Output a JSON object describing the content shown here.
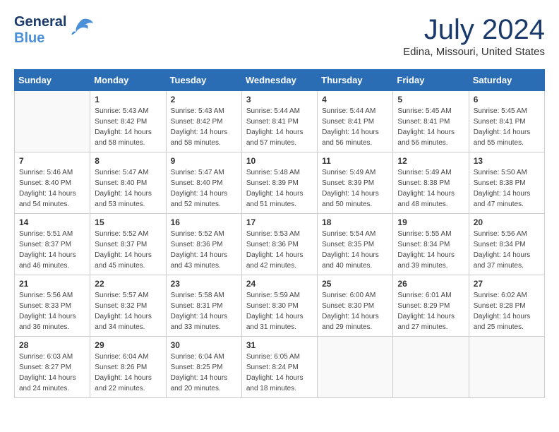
{
  "logo": {
    "line1": "General",
    "line2": "Blue"
  },
  "title": "July 2024",
  "location": "Edina, Missouri, United States",
  "days_of_week": [
    "Sunday",
    "Monday",
    "Tuesday",
    "Wednesday",
    "Thursday",
    "Friday",
    "Saturday"
  ],
  "weeks": [
    [
      {
        "day": "",
        "info": ""
      },
      {
        "day": "1",
        "info": "Sunrise: 5:43 AM\nSunset: 8:42 PM\nDaylight: 14 hours\nand 58 minutes."
      },
      {
        "day": "2",
        "info": "Sunrise: 5:43 AM\nSunset: 8:42 PM\nDaylight: 14 hours\nand 58 minutes."
      },
      {
        "day": "3",
        "info": "Sunrise: 5:44 AM\nSunset: 8:41 PM\nDaylight: 14 hours\nand 57 minutes."
      },
      {
        "day": "4",
        "info": "Sunrise: 5:44 AM\nSunset: 8:41 PM\nDaylight: 14 hours\nand 56 minutes."
      },
      {
        "day": "5",
        "info": "Sunrise: 5:45 AM\nSunset: 8:41 PM\nDaylight: 14 hours\nand 56 minutes."
      },
      {
        "day": "6",
        "info": "Sunrise: 5:45 AM\nSunset: 8:41 PM\nDaylight: 14 hours\nand 55 minutes."
      }
    ],
    [
      {
        "day": "7",
        "info": "Sunrise: 5:46 AM\nSunset: 8:40 PM\nDaylight: 14 hours\nand 54 minutes."
      },
      {
        "day": "8",
        "info": "Sunrise: 5:47 AM\nSunset: 8:40 PM\nDaylight: 14 hours\nand 53 minutes."
      },
      {
        "day": "9",
        "info": "Sunrise: 5:47 AM\nSunset: 8:40 PM\nDaylight: 14 hours\nand 52 minutes."
      },
      {
        "day": "10",
        "info": "Sunrise: 5:48 AM\nSunset: 8:39 PM\nDaylight: 14 hours\nand 51 minutes."
      },
      {
        "day": "11",
        "info": "Sunrise: 5:49 AM\nSunset: 8:39 PM\nDaylight: 14 hours\nand 50 minutes."
      },
      {
        "day": "12",
        "info": "Sunrise: 5:49 AM\nSunset: 8:38 PM\nDaylight: 14 hours\nand 48 minutes."
      },
      {
        "day": "13",
        "info": "Sunrise: 5:50 AM\nSunset: 8:38 PM\nDaylight: 14 hours\nand 47 minutes."
      }
    ],
    [
      {
        "day": "14",
        "info": "Sunrise: 5:51 AM\nSunset: 8:37 PM\nDaylight: 14 hours\nand 46 minutes."
      },
      {
        "day": "15",
        "info": "Sunrise: 5:52 AM\nSunset: 8:37 PM\nDaylight: 14 hours\nand 45 minutes."
      },
      {
        "day": "16",
        "info": "Sunrise: 5:52 AM\nSunset: 8:36 PM\nDaylight: 14 hours\nand 43 minutes."
      },
      {
        "day": "17",
        "info": "Sunrise: 5:53 AM\nSunset: 8:36 PM\nDaylight: 14 hours\nand 42 minutes."
      },
      {
        "day": "18",
        "info": "Sunrise: 5:54 AM\nSunset: 8:35 PM\nDaylight: 14 hours\nand 40 minutes."
      },
      {
        "day": "19",
        "info": "Sunrise: 5:55 AM\nSunset: 8:34 PM\nDaylight: 14 hours\nand 39 minutes."
      },
      {
        "day": "20",
        "info": "Sunrise: 5:56 AM\nSunset: 8:34 PM\nDaylight: 14 hours\nand 37 minutes."
      }
    ],
    [
      {
        "day": "21",
        "info": "Sunrise: 5:56 AM\nSunset: 8:33 PM\nDaylight: 14 hours\nand 36 minutes."
      },
      {
        "day": "22",
        "info": "Sunrise: 5:57 AM\nSunset: 8:32 PM\nDaylight: 14 hours\nand 34 minutes."
      },
      {
        "day": "23",
        "info": "Sunrise: 5:58 AM\nSunset: 8:31 PM\nDaylight: 14 hours\nand 33 minutes."
      },
      {
        "day": "24",
        "info": "Sunrise: 5:59 AM\nSunset: 8:30 PM\nDaylight: 14 hours\nand 31 minutes."
      },
      {
        "day": "25",
        "info": "Sunrise: 6:00 AM\nSunset: 8:30 PM\nDaylight: 14 hours\nand 29 minutes."
      },
      {
        "day": "26",
        "info": "Sunrise: 6:01 AM\nSunset: 8:29 PM\nDaylight: 14 hours\nand 27 minutes."
      },
      {
        "day": "27",
        "info": "Sunrise: 6:02 AM\nSunset: 8:28 PM\nDaylight: 14 hours\nand 25 minutes."
      }
    ],
    [
      {
        "day": "28",
        "info": "Sunrise: 6:03 AM\nSunset: 8:27 PM\nDaylight: 14 hours\nand 24 minutes."
      },
      {
        "day": "29",
        "info": "Sunrise: 6:04 AM\nSunset: 8:26 PM\nDaylight: 14 hours\nand 22 minutes."
      },
      {
        "day": "30",
        "info": "Sunrise: 6:04 AM\nSunset: 8:25 PM\nDaylight: 14 hours\nand 20 minutes."
      },
      {
        "day": "31",
        "info": "Sunrise: 6:05 AM\nSunset: 8:24 PM\nDaylight: 14 hours\nand 18 minutes."
      },
      {
        "day": "",
        "info": ""
      },
      {
        "day": "",
        "info": ""
      },
      {
        "day": "",
        "info": ""
      }
    ]
  ]
}
